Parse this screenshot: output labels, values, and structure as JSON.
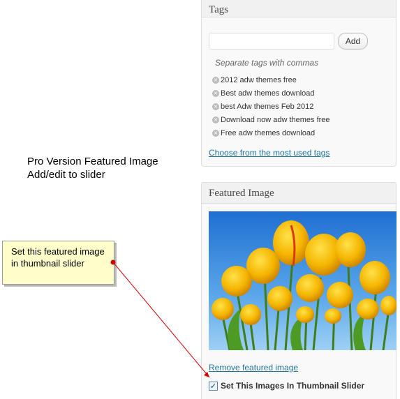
{
  "tags_box": {
    "title": "Tags",
    "input_value": "",
    "add_label": "Add",
    "howto": "Separate tags with commas",
    "tags": [
      "2012 adw themes free",
      "Best adw themes download",
      "best Adw themes Feb 2012",
      "Download now adw themes free",
      "Free adw themes download"
    ],
    "remove_tag_icon": "x-icon",
    "most_used_link": "Choose from the most used tags"
  },
  "featured_box": {
    "title": "Featured Image",
    "image_subject": "yellow tulips against a blue sky",
    "remove_link": "Remove featured image",
    "slider_checkbox_label": "Set This Images In Thumbnail Slider",
    "slider_checked": true
  },
  "annotation": {
    "pro_note_line1": "Pro Version Featured Image",
    "pro_note_line2": "Add/edit to slider",
    "callout_text": "Set this featured image in thumbnail slider",
    "arrow_color": "#cc0000",
    "callout_color": "#ffffcc"
  },
  "colors": {
    "link": "#21759b",
    "box_border": "#dfdfdf",
    "box_header": "#f1f1f1"
  }
}
